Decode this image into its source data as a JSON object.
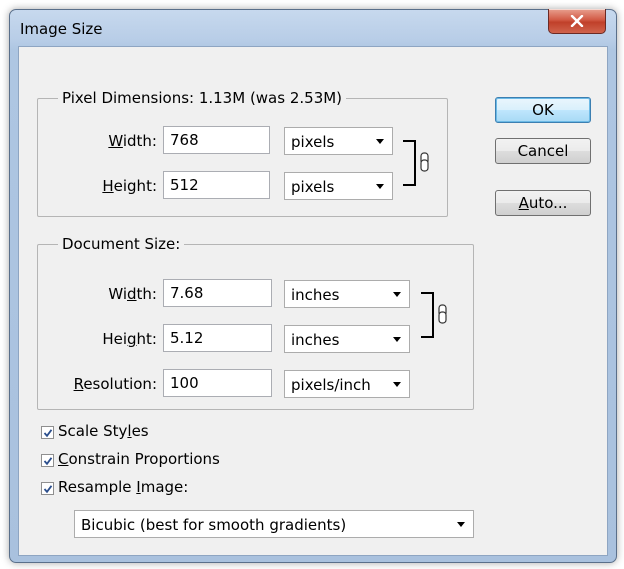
{
  "window": {
    "title": "Image Size"
  },
  "pixel_dimensions": {
    "legend": "Pixel Dimensions:  1.13M (was 2.53M)",
    "width_label_pre": "",
    "width_label_u": "W",
    "width_label_post": "idth:",
    "width_value": "768",
    "width_unit": "pixels",
    "height_label_pre": "",
    "height_label_u": "H",
    "height_label_post": "eight:",
    "height_value": "512",
    "height_unit": "pixels"
  },
  "document_size": {
    "legend": "Document Size:",
    "width_label_pre": "Wi",
    "width_label_u": "d",
    "width_label_post": "th:",
    "width_value": "7.68",
    "width_unit": "inches",
    "height_label_pre": "Hei",
    "height_label_u": "g",
    "height_label_post": "ht:",
    "height_value": "5.12",
    "height_unit": "inches",
    "res_label_pre": "",
    "res_label_u": "R",
    "res_label_post": "esolution:",
    "res_value": "100",
    "res_unit": "pixels/inch"
  },
  "buttons": {
    "ok": "OK",
    "cancel": "Cancel",
    "auto_u": "A",
    "auto_post": "uto..."
  },
  "options": {
    "scale_styles_pre": "Scale Sty",
    "scale_styles_u": "l",
    "scale_styles_post": "es",
    "scale_styles_checked": true,
    "constrain_u": "C",
    "constrain_post": "onstrain Proportions",
    "constrain_checked": true,
    "resample_pre": "Resample ",
    "resample_u": "I",
    "resample_post": "mage:",
    "resample_checked": true
  },
  "resample_method": "Bicubic (best for smooth gradients)"
}
